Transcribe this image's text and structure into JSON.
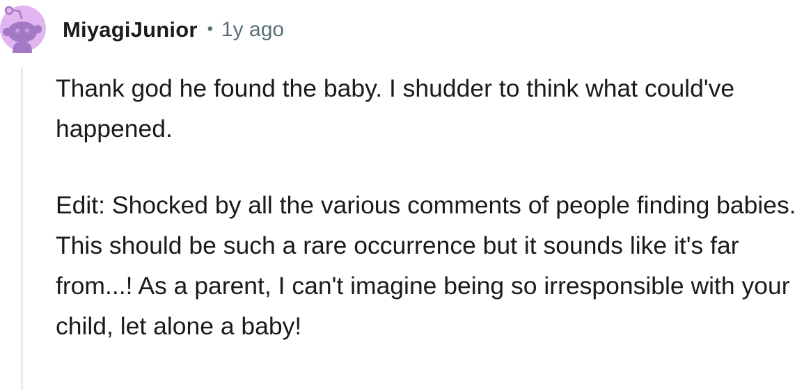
{
  "comment": {
    "author": "MiyagiJunior",
    "separator": "•",
    "age": "1y ago",
    "paragraphs": [
      "Thank god he found the baby. I shudder to think what could've happened.",
      "Edit: Shocked by all the various comments of people finding babies. This should be such a rare occurrence but it sounds like it's far from...! As a parent, I can't imagine being so irresponsible with your child, let alone a baby!"
    ]
  },
  "avatar": {
    "icon": "snoo-avatar-icon",
    "background_color": "#e3b5f0",
    "figure_color": "#a179c4"
  }
}
